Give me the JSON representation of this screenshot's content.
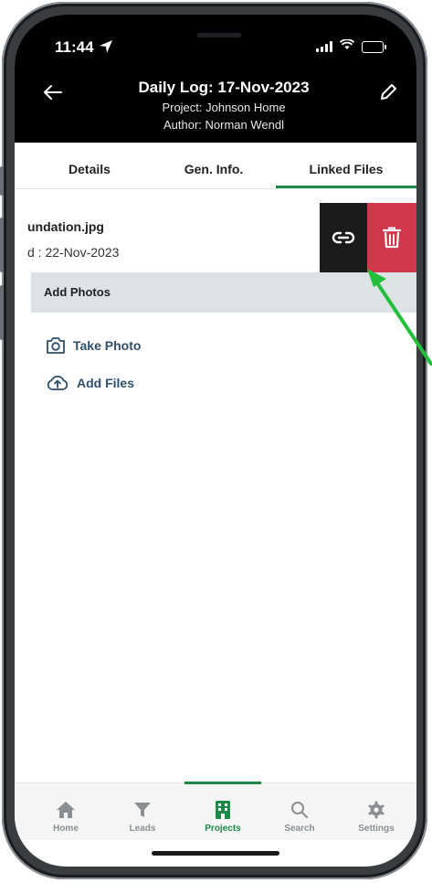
{
  "status": {
    "time": "11:44"
  },
  "header": {
    "title": "Daily Log: 17-Nov-2023",
    "project": "Project: Johnson Home",
    "author": "Author: Norman Wendl"
  },
  "tabs": [
    {
      "label": "Details"
    },
    {
      "label": "Gen. Info."
    },
    {
      "label": "Linked Files"
    }
  ],
  "file": {
    "name": "undation.jpg",
    "date": "d : 22-Nov-2023"
  },
  "section": {
    "title": "Add Photos"
  },
  "actions": {
    "take_photo": "Take Photo",
    "add_files": "Add Files"
  },
  "bottom_nav": [
    {
      "label": "Home",
      "icon": "home-icon"
    },
    {
      "label": "Leads",
      "icon": "filter-icon"
    },
    {
      "label": "Projects",
      "icon": "building-icon"
    },
    {
      "label": "Search",
      "icon": "search-icon"
    },
    {
      "label": "Settings",
      "icon": "gear-icon"
    }
  ],
  "colors": {
    "accent": "#1e8a4a",
    "delete": "#d0374a",
    "link_bg": "#1b1b1b",
    "section_bg": "#dde3e5",
    "action_text": "#2f4f6a",
    "annotation_arrow": "#22c03a"
  }
}
